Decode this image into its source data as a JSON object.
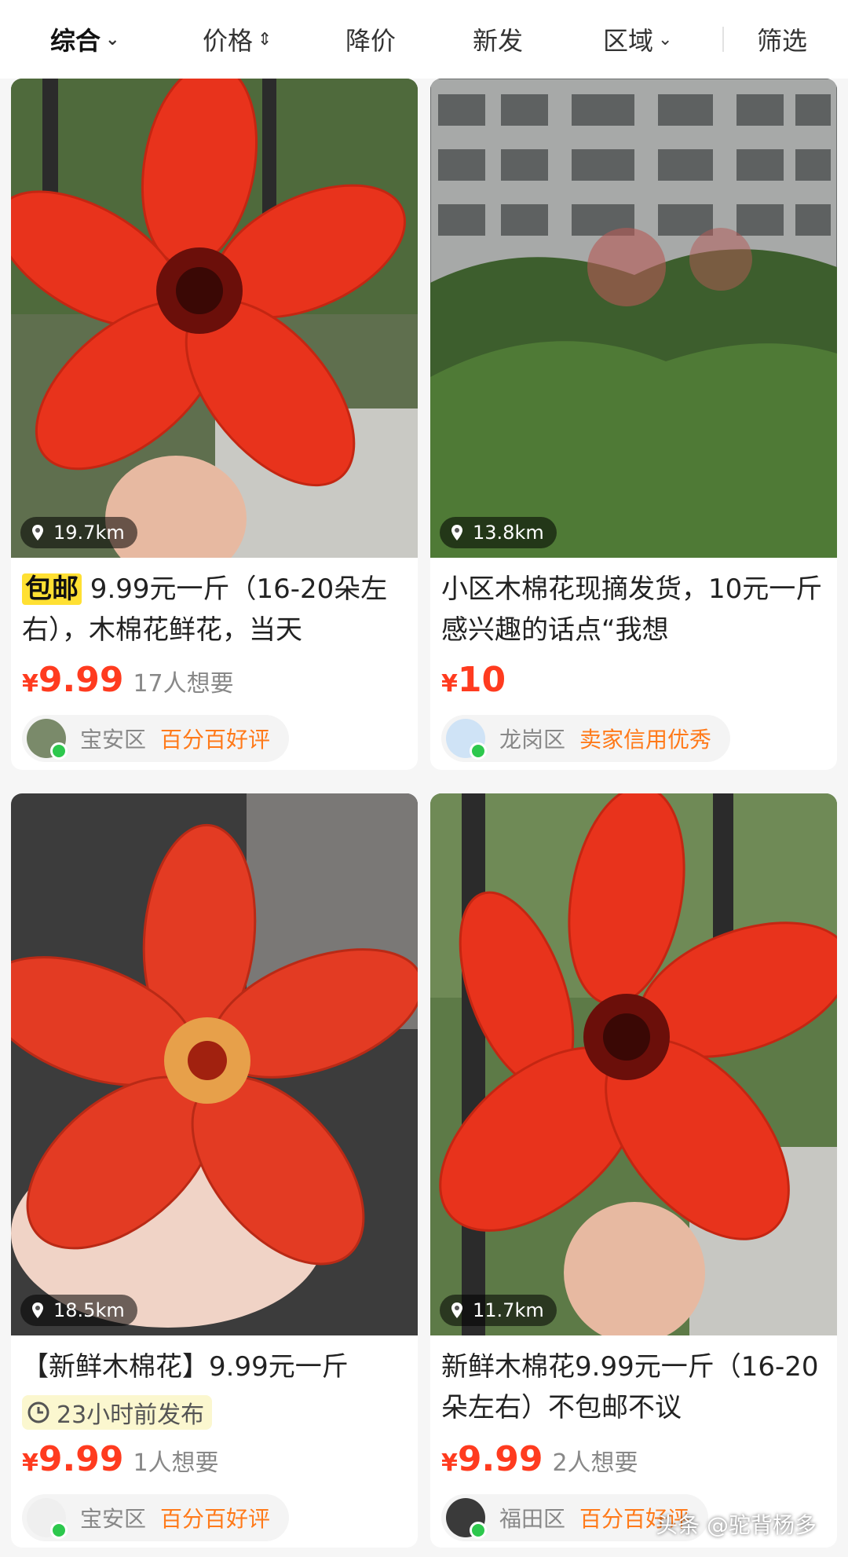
{
  "tabs": [
    {
      "label": "综合",
      "arrow": "⌄"
    },
    {
      "label": "价格",
      "arrow": "⇕"
    },
    {
      "label": "降价",
      "arrow": ""
    },
    {
      "label": "新发",
      "arrow": ""
    },
    {
      "label": "区域",
      "arrow": "⌄"
    },
    {
      "label": "筛选",
      "arrow": ""
    }
  ],
  "items": [
    {
      "distance": "19.7km",
      "badge": "包邮",
      "title": " 9.99元一斤（16-20朵左右），木棉花鲜花，当天",
      "price_symbol": "¥",
      "price": "9.99",
      "wants": "17人想要",
      "district": "宝安区",
      "rating": "百分百好评"
    },
    {
      "distance": "13.8km",
      "badge": "",
      "title": "小区木棉花现摘发货，10元一斤 感兴趣的话点“我想",
      "price_symbol": "¥",
      "price": "10",
      "wants": "",
      "district": "龙岗区",
      "rating": "卖家信用优秀"
    },
    {
      "distance": "18.5km",
      "badge": "",
      "title": "【新鲜木棉花】9.99元一斤",
      "posted": "23小时前发布",
      "price_symbol": "¥",
      "price": "9.99",
      "wants": "1人想要",
      "district": "宝安区",
      "rating": "百分百好评"
    },
    {
      "distance": "11.7km",
      "badge": "",
      "title": "新鲜木棉花9.99元一斤（16-20朵左右）不包邮不议",
      "price_symbol": "¥",
      "price": "9.99",
      "wants": "2人想要",
      "district": "福田区",
      "rating": "百分百好评"
    }
  ],
  "watermark": "头条 @驼背杨多",
  "colors": {
    "price": "#ff3b1f",
    "rating": "#ff7a1a",
    "flower": "#e8331c",
    "online": "#2dc84d"
  }
}
